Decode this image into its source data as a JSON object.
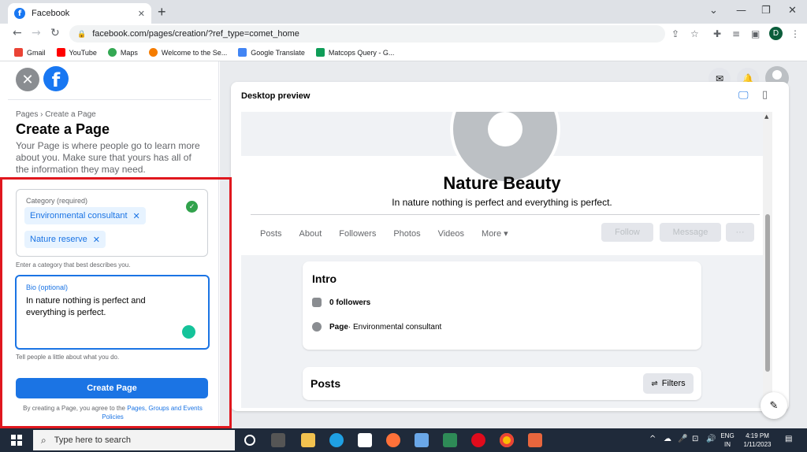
{
  "browser": {
    "tab_title": "Facebook",
    "url": "facebook.com/pages/creation/?ref_type=comet_home",
    "profile_initial": "D",
    "bookmarks": [
      {
        "label": "Gmail",
        "color": "#ea4335"
      },
      {
        "label": "YouTube",
        "color": "#ff0000"
      },
      {
        "label": "Maps",
        "color": "#34a853"
      },
      {
        "label": "Welcome to the Se...",
        "color": "#f57c00"
      },
      {
        "label": "Google Translate",
        "color": "#4285f4"
      },
      {
        "label": "Matcops Query - G...",
        "color": "#0f9d58"
      }
    ]
  },
  "left_panel": {
    "breadcrumb": "Pages › Create a Page",
    "title": "Create a Page",
    "description": "Your Page is where people go to learn more about you. Make sure that yours has all of the information they may need.",
    "category_label": "Category (required)",
    "categories": [
      "Environmental consultant",
      "Nature reserve"
    ],
    "category_hint": "Enter a category that best describes you.",
    "bio_label": "Bio (optional)",
    "bio_value": "In nature nothing is perfect and everything is perfect.",
    "bio_hint": "Tell people a little about what you do.",
    "create_button": "Create Page",
    "terms_prefix": "By creating a Page, you agree to the ",
    "terms_link": "Pages, Groups and Events Policies"
  },
  "preview": {
    "label": "Desktop preview",
    "page_name": "Nature Beauty",
    "page_bio": "In nature nothing is perfect and everything is perfect.",
    "tabs": [
      "Posts",
      "About",
      "Followers",
      "Photos",
      "Videos",
      "More ▾"
    ],
    "follow_button": "Follow",
    "message_button": "Message",
    "more_button": "···",
    "intro_title": "Intro",
    "followers": "0 followers",
    "page_type_prefix": "Page",
    "page_type": " · Environmental consultant",
    "posts_title": "Posts",
    "filters_button": "Filters"
  },
  "taskbar": {
    "search_placeholder": "Type here to search",
    "lang": "ENG",
    "region": "IN",
    "time": "4:19 PM",
    "date": "1/11/2023"
  },
  "colors": {
    "fb_blue": "#1877f2",
    "highlight_red": "#e0171e",
    "chip_bg": "#e7f3ff"
  }
}
